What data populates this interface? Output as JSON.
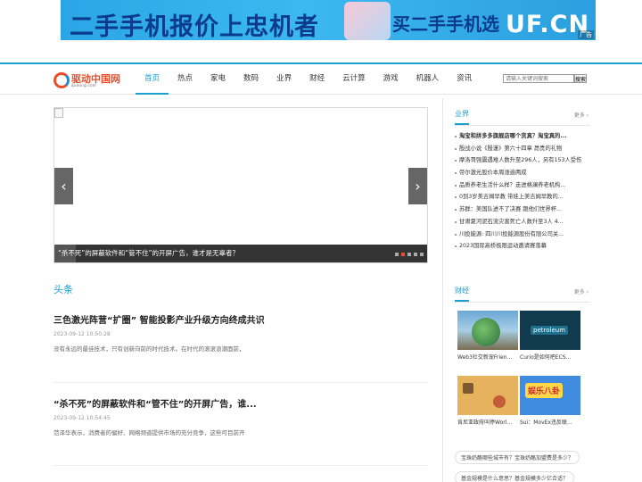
{
  "banner": {
    "left_text": "二手手机报价上忠机者",
    "right_text": "买二手手机选",
    "right_domain": "UF.CN",
    "ad_tag": "广告"
  },
  "site": {
    "logo_name": "驱动中国网",
    "logo_sub": "qudong.com"
  },
  "nav": {
    "items": [
      "首页",
      "热点",
      "家电",
      "数码",
      "业界",
      "财经",
      "云计算",
      "游戏",
      "机器人",
      "资讯"
    ],
    "active_index": 0
  },
  "search": {
    "placeholder": "请输入关键词搜索",
    "button_label": "搜索"
  },
  "slider": {
    "caption": "“杀不死”的屏蔽软件和“管不住”的开屏广告，谁才是无辜者？",
    "prev": "‹",
    "next": "›",
    "dot_count": 5,
    "active_dot": 1
  },
  "headline": {
    "section_title": "头条",
    "articles": [
      {
        "title": "三色激光阵营“扩圈” 智能投影产业升级方向终成共识",
        "date": "2023-09-12 10:50:28",
        "summary": "没有永远的最佳技术，只有创新向前的时代技术。在时代的滚滚浪潮面前，"
      },
      {
        "title": "“杀不死”的屏蔽软件和“管不住”的开屏广告，谁...",
        "date": "2023-09-12 10:54:45",
        "summary": "范泽华表示，消费者的偏好、网络频道提供市场的充分竞争，这些可目前开"
      }
    ]
  },
  "industry": {
    "label": "业界",
    "more": "更多 ›",
    "items": [
      "淘宝和拼多多旗舰店哪个货真？淘宝真的...",
      "殷战小说《殷谨》第六十四章 昂贵的礼物",
      "摩洛哥强震遇难人数升至296人，另有153人受伤",
      "帝尔激光股价本周涨逾两成",
      "品质养老生活什么样？走进格澜养老机构...",
      "0到3岁美吉姆早教 带娃上美吉姆早教的...",
      "苏群：美国队进不了决赛 跟他们世界杯...",
      "甘肃夏河泥石流灾害死亡人数升至3人 4...",
      "川投能源: 四川川投能源股份有限公司关...",
      "2023国际高桥极限运动邀请赛落幕"
    ]
  },
  "finance": {
    "label": "财经",
    "more": "更多 ›",
    "thumbs": [
      {
        "caption": "Web3社交新宠Frien...",
        "image_text": ""
      },
      {
        "caption": "Curio是如何把ECS...",
        "image_text": "petroleum"
      },
      {
        "caption": "肯尼亚政府叫停Worl...",
        "image_text": ""
      },
      {
        "caption": "Sui：MovEx违反联...",
        "image_text": "娱乐八卦"
      }
    ]
  },
  "tags": [
    "宝珠奶酪哪些城市有？宝珠奶酪加盟费是多少？",
    "基金规模是什么意思？基金规模多少亿合适？"
  ]
}
